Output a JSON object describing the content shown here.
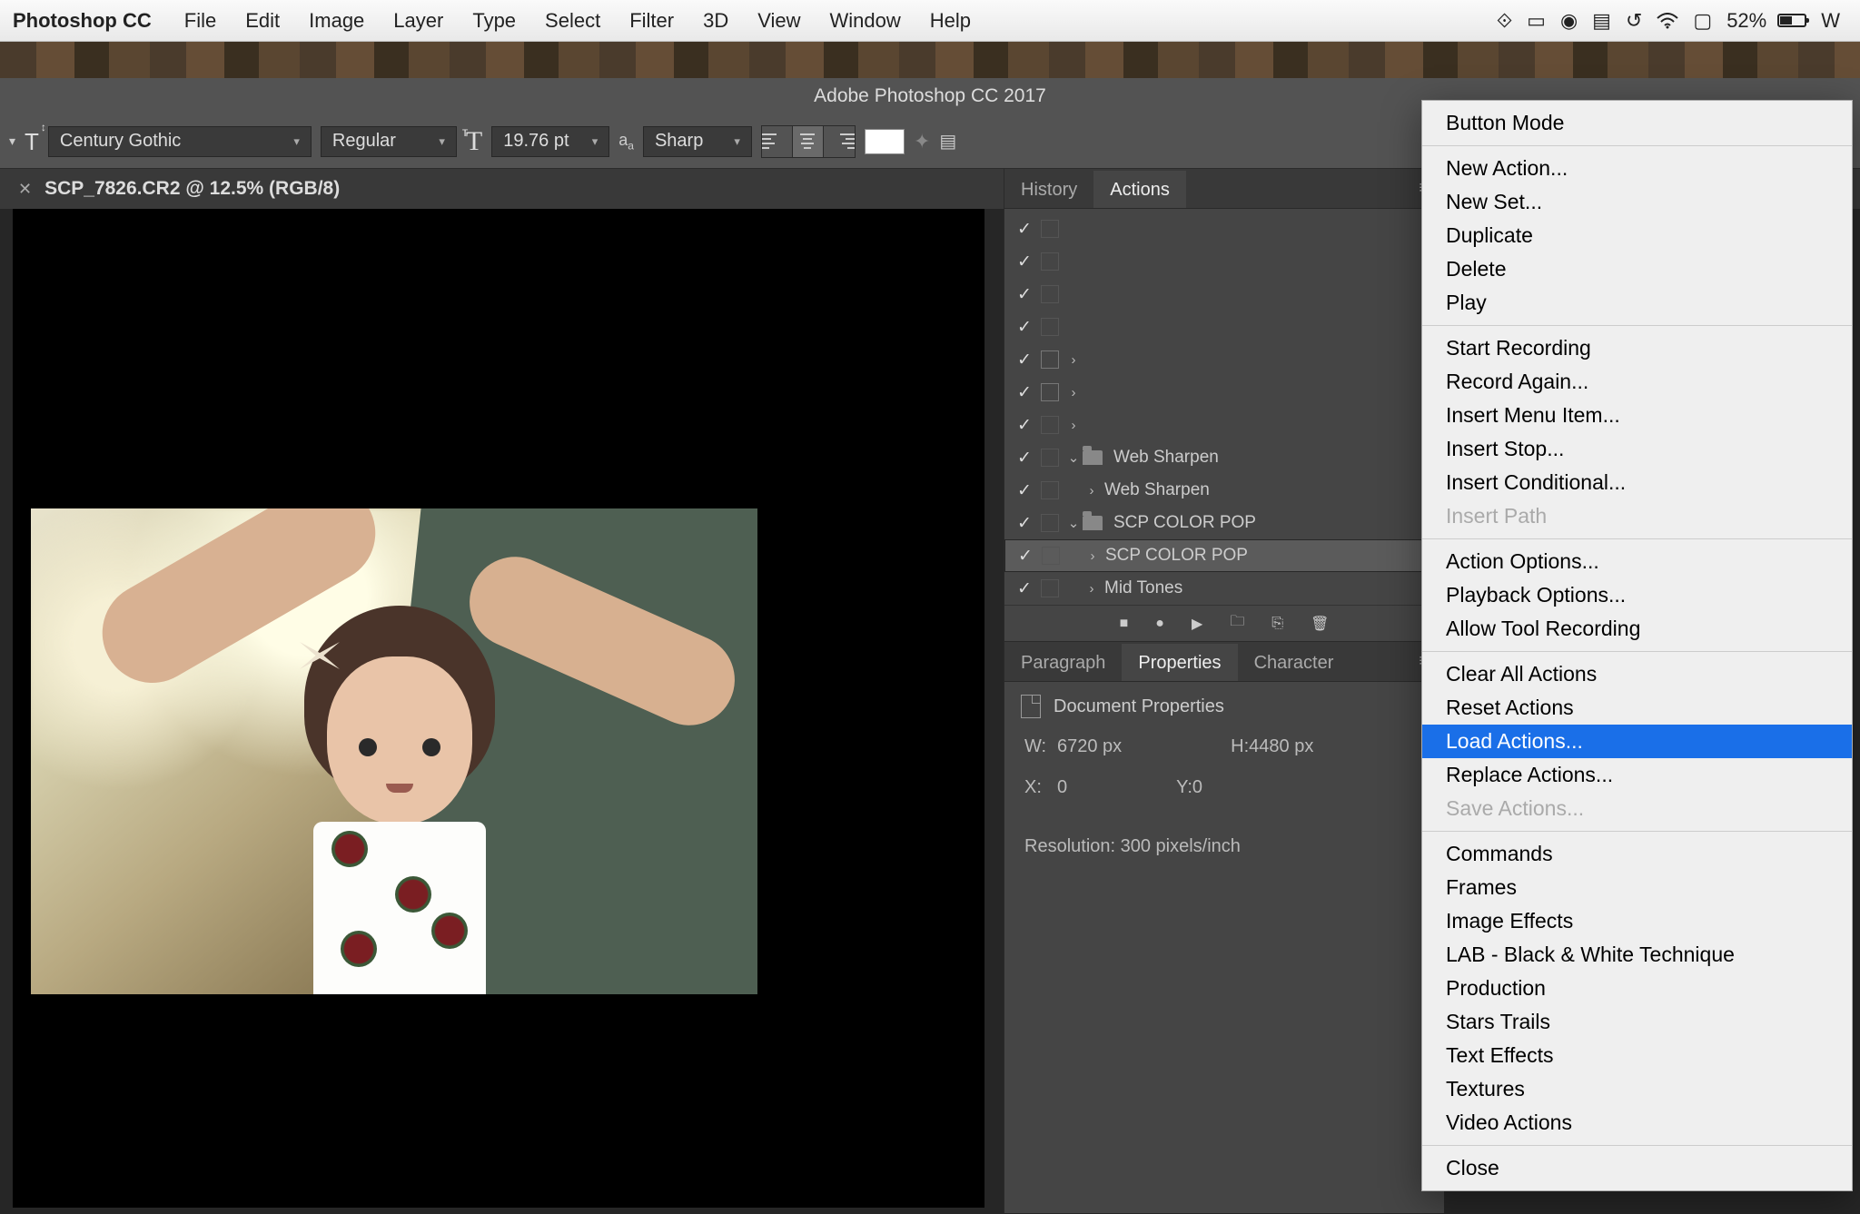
{
  "menubar": {
    "app": "Photoshop CC",
    "items": [
      "File",
      "Edit",
      "Image",
      "Layer",
      "Type",
      "Select",
      "Filter",
      "3D",
      "View",
      "Window",
      "Help"
    ],
    "battery_pct": "52%",
    "wcut": "W"
  },
  "window": {
    "title": "Adobe Photoshop CC 2017"
  },
  "options": {
    "font": "Century Gothic",
    "style": "Regular",
    "size": "19.76 pt",
    "aa": "Sharp"
  },
  "doc_tab": "SCP_7826.CR2 @ 12.5% (RGB/8)",
  "panels": {
    "top_tabs": [
      "History",
      "Actions"
    ],
    "active_top": "Actions",
    "actions": [
      {
        "check": true,
        "box": false,
        "chev": "",
        "t": ""
      },
      {
        "check": true,
        "box": false,
        "chev": "",
        "t": ""
      },
      {
        "check": true,
        "box": false,
        "chev": "",
        "t": ""
      },
      {
        "check": true,
        "box": false,
        "chev": "",
        "t": ""
      },
      {
        "check": true,
        "box": true,
        "chev": "›",
        "t": ""
      },
      {
        "check": true,
        "box": true,
        "chev": "›",
        "t": ""
      },
      {
        "check": true,
        "box": false,
        "chev": "›",
        "t": ""
      },
      {
        "check": true,
        "box": false,
        "chev": "v",
        "folder": true,
        "t": "Web Sharpen"
      },
      {
        "check": true,
        "box": false,
        "chev": "›",
        "ind": 1,
        "t": "Web Sharpen"
      },
      {
        "check": true,
        "box": false,
        "chev": "v",
        "folder": true,
        "t": "SCP COLOR POP"
      },
      {
        "check": true,
        "box": false,
        "chev": "›",
        "ind": 1,
        "t": "SCP COLOR POP",
        "sel": true
      },
      {
        "check": true,
        "box": false,
        "chev": "›",
        "ind": 1,
        "t": "Mid Tones"
      }
    ],
    "mid_tabs": [
      "Paragraph",
      "Properties",
      "Character"
    ],
    "active_mid": "Properties",
    "props_title": "Document Properties",
    "props": {
      "w": "6720 px",
      "h": "4480 px",
      "x": "0",
      "y": "0",
      "res": "Resolution: 300 pixels/inch"
    }
  },
  "context_menu": {
    "groups": [
      [
        "Button Mode"
      ],
      [
        "New Action...",
        "New Set...",
        "Duplicate",
        "Delete",
        "Play"
      ],
      [
        "Start Recording",
        "Record Again...",
        "Insert Menu Item...",
        "Insert Stop...",
        "Insert Conditional...",
        "Insert Path"
      ],
      [
        "Action Options...",
        "Playback Options...",
        "Allow Tool Recording"
      ],
      [
        "Clear All Actions",
        "Reset Actions",
        "Load Actions...",
        "Replace Actions...",
        "Save Actions..."
      ],
      [
        "Commands",
        "Frames",
        "Image Effects",
        "LAB - Black & White Technique",
        "Production",
        "Stars Trails",
        "Text Effects",
        "Textures",
        "Video Actions"
      ],
      [
        "Close"
      ]
    ],
    "highlighted": "Load Actions...",
    "disabled": [
      "Insert Path",
      "Save Actions..."
    ]
  }
}
